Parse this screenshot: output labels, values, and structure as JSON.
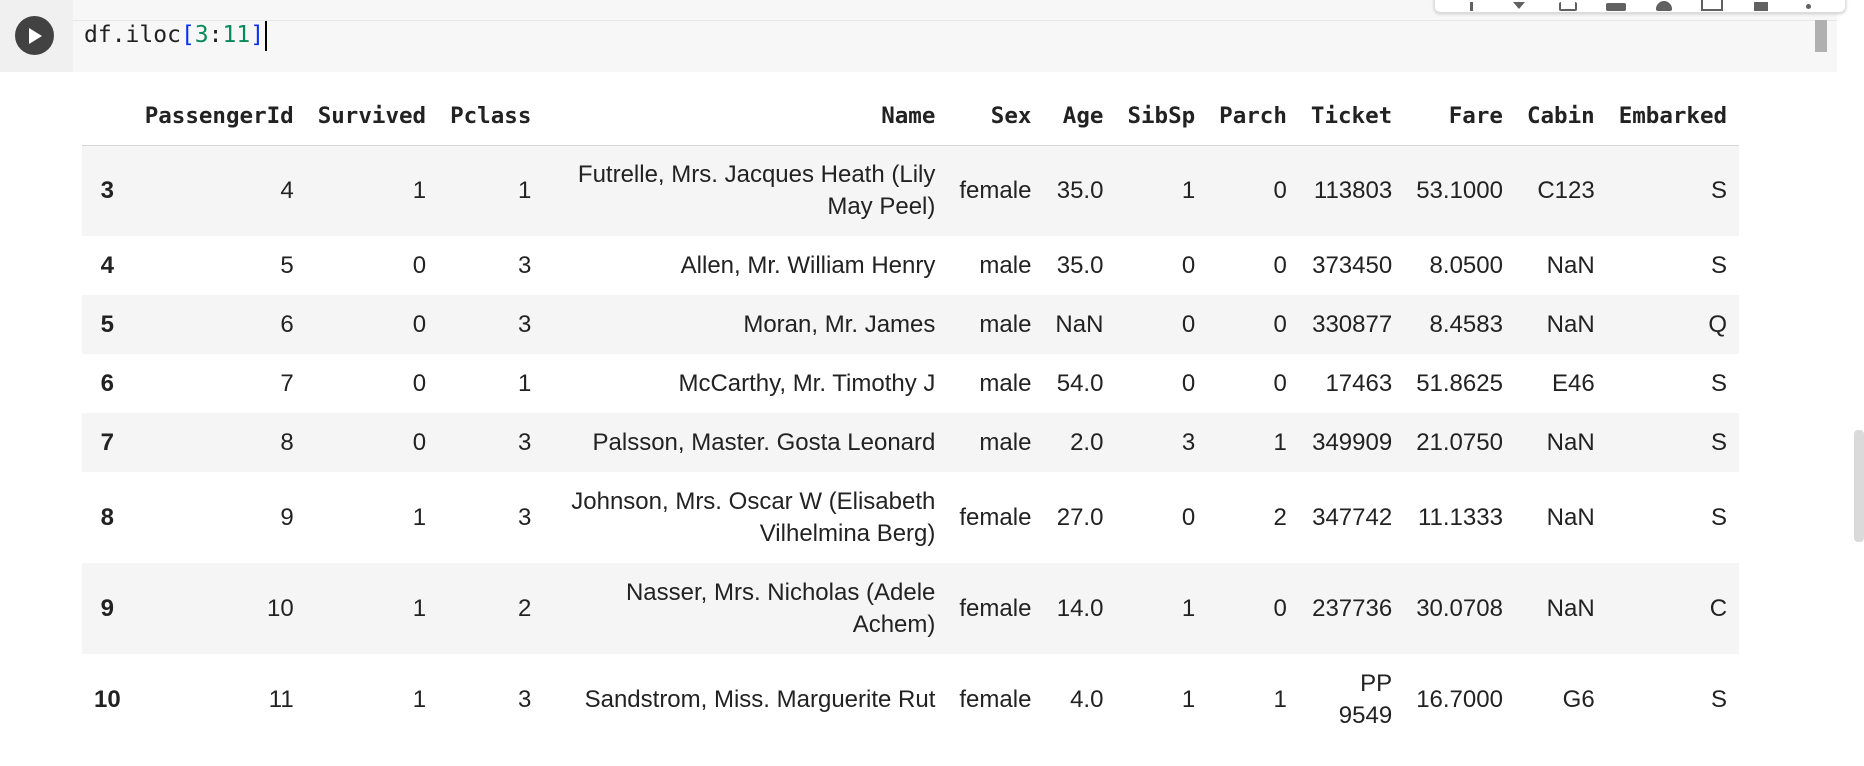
{
  "cell": {
    "code": {
      "prefix": "df.iloc",
      "open_bracket": "[",
      "start": "3",
      "colon": ":",
      "end": "11",
      "close_bracket": "]"
    },
    "toolbar_icons": [
      "arrow-up-icon",
      "arrow-down-icon",
      "link-icon",
      "comment-icon",
      "gear-icon",
      "mirror-cell-icon",
      "delete-icon",
      "more-vert-icon"
    ]
  },
  "colors": {
    "run_button": "#424242",
    "gutter": "#f0f0f0",
    "editor_bg": "#f7f7f7",
    "row_stripe": "#f5f5f5",
    "code_bracket": "#0431fa",
    "code_number": "#09885a"
  },
  "dataframe": {
    "columns": [
      "",
      "PassengerId",
      "Survived",
      "Pclass",
      "Name",
      "Sex",
      "Age",
      "SibSp",
      "Parch",
      "Ticket",
      "Fare",
      "Cabin",
      "Embarked"
    ],
    "rows": [
      {
        "index": "3",
        "cells": [
          "4",
          "1",
          "1",
          "Futrelle, Mrs. Jacques Heath (Lily May Peel)",
          "female",
          "35.0",
          "1",
          "0",
          "113803",
          "53.1000",
          "C123",
          "S"
        ]
      },
      {
        "index": "4",
        "cells": [
          "5",
          "0",
          "3",
          "Allen, Mr. William Henry",
          "male",
          "35.0",
          "0",
          "0",
          "373450",
          "8.0500",
          "NaN",
          "S"
        ]
      },
      {
        "index": "5",
        "cells": [
          "6",
          "0",
          "3",
          "Moran, Mr. James",
          "male",
          "NaN",
          "0",
          "0",
          "330877",
          "8.4583",
          "NaN",
          "Q"
        ]
      },
      {
        "index": "6",
        "cells": [
          "7",
          "0",
          "1",
          "McCarthy, Mr. Timothy J",
          "male",
          "54.0",
          "0",
          "0",
          "17463",
          "51.8625",
          "E46",
          "S"
        ]
      },
      {
        "index": "7",
        "cells": [
          "8",
          "0",
          "3",
          "Palsson, Master. Gosta Leonard",
          "male",
          "2.0",
          "3",
          "1",
          "349909",
          "21.0750",
          "NaN",
          "S"
        ]
      },
      {
        "index": "8",
        "cells": [
          "9",
          "1",
          "3",
          "Johnson, Mrs. Oscar W (Elisabeth Vilhelmina Berg)",
          "female",
          "27.0",
          "0",
          "2",
          "347742",
          "11.1333",
          "NaN",
          "S"
        ]
      },
      {
        "index": "9",
        "cells": [
          "10",
          "1",
          "2",
          "Nasser, Mrs. Nicholas (Adele Achem)",
          "female",
          "14.0",
          "1",
          "0",
          "237736",
          "30.0708",
          "NaN",
          "C"
        ]
      },
      {
        "index": "10",
        "cells": [
          "11",
          "1",
          "3",
          "Sandstrom, Miss. Marguerite Rut",
          "female",
          "4.0",
          "1",
          "1",
          "PP 9549",
          "16.7000",
          "G6",
          "S"
        ]
      }
    ]
  }
}
